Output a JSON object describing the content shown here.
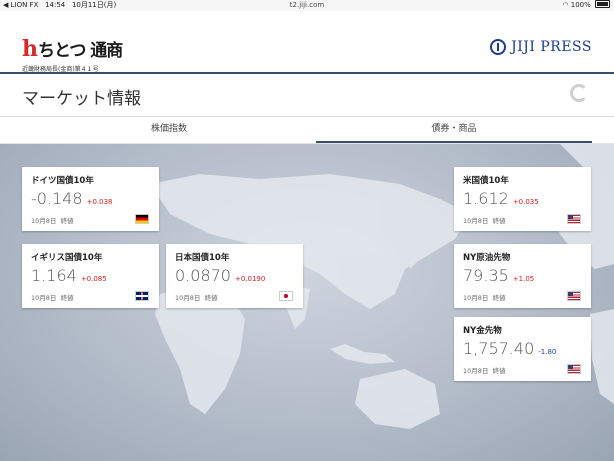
{
  "status_bar": {
    "carrier": "◀ LION FX",
    "time": "14:54",
    "date": "10月11日(月)",
    "url": "t2.jiji.com",
    "battery": "100%"
  },
  "header": {
    "logo_h": "h",
    "logo_name": "ちとつ 通商",
    "logo_sub": "近畿財務局長(金商)第４１号",
    "partner_logo": "JIJI PRESS"
  },
  "page": {
    "title": "マーケット情報"
  },
  "tabs": [
    {
      "label": "株価指数",
      "active": false
    },
    {
      "label": "債券・商品",
      "active": true
    }
  ],
  "cards": [
    {
      "name": "ドイツ国債10年",
      "value": "-0.148",
      "change": "+0.038",
      "direction": "up",
      "date": "10月8日",
      "status": "終値",
      "flag": "germany-flag-icon"
    },
    {
      "name": "米国債10年",
      "value": "1.612",
      "change": "+0.035",
      "direction": "up",
      "date": "10月8日",
      "status": "終値",
      "flag": "us-flag-icon"
    },
    {
      "name": "イギリス国債10年",
      "value": "1.164",
      "change": "+0.085",
      "direction": "up",
      "date": "10月8日",
      "status": "終値",
      "flag": "uk-flag-icon"
    },
    {
      "name": "日本国債10年",
      "value": "0.0870",
      "change": "+0.0190",
      "direction": "up",
      "date": "10月8日",
      "status": "終値",
      "flag": "japan-flag-icon"
    },
    {
      "name": "NY原油先物",
      "value": "79.35",
      "change": "+1.05",
      "direction": "up",
      "date": "10月8日",
      "status": "終値",
      "flag": "us-flag-icon"
    },
    {
      "name": "NY金先物",
      "value": "1,757.40",
      "change": "-1.80",
      "direction": "down",
      "date": "10月8日",
      "status": "終値",
      "flag": "us-flag-icon"
    }
  ],
  "colors": {
    "up": "#d52020",
    "down": "#1f45a8",
    "accent": "#3a4d68"
  }
}
